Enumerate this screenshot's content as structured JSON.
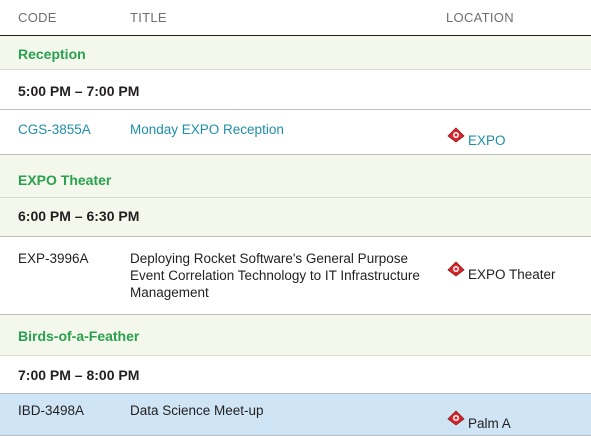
{
  "header": {
    "code": "CODE",
    "title": "TITLE",
    "location": "LOCATION"
  },
  "sections": [
    {
      "category": "Reception",
      "time": "5:00 PM – 7:00 PM",
      "sessions": [
        {
          "code": "CGS-3855A",
          "title": "Monday EXPO Reception",
          "location": "EXPO",
          "location_icon": "map-pin-icon"
        }
      ]
    },
    {
      "category": "EXPO Theater",
      "time": "6:00 PM – 6:30 PM",
      "sessions": [
        {
          "code": "EXP-3996A",
          "title": "Deploying Rocket Software's General Purpose Event Correlation Technology to IT Infrastructure Management",
          "location": "EXPO Theater",
          "location_icon": "map-pin-icon"
        }
      ]
    },
    {
      "category": "Birds-of-a-Feather",
      "time": "7:00 PM – 8:00 PM",
      "sessions": [
        {
          "code": "IBD-3498A",
          "title": "Data Science Meet-up",
          "location": "Palm A",
          "location_icon": "map-pin-icon"
        }
      ]
    }
  ],
  "colors": {
    "category_text": "#2ba04e",
    "link_text": "#1f8fa7",
    "band_shade": "#f3f7ec",
    "selected_row": "#cfe5f5",
    "pin_red": "#d9262b"
  }
}
